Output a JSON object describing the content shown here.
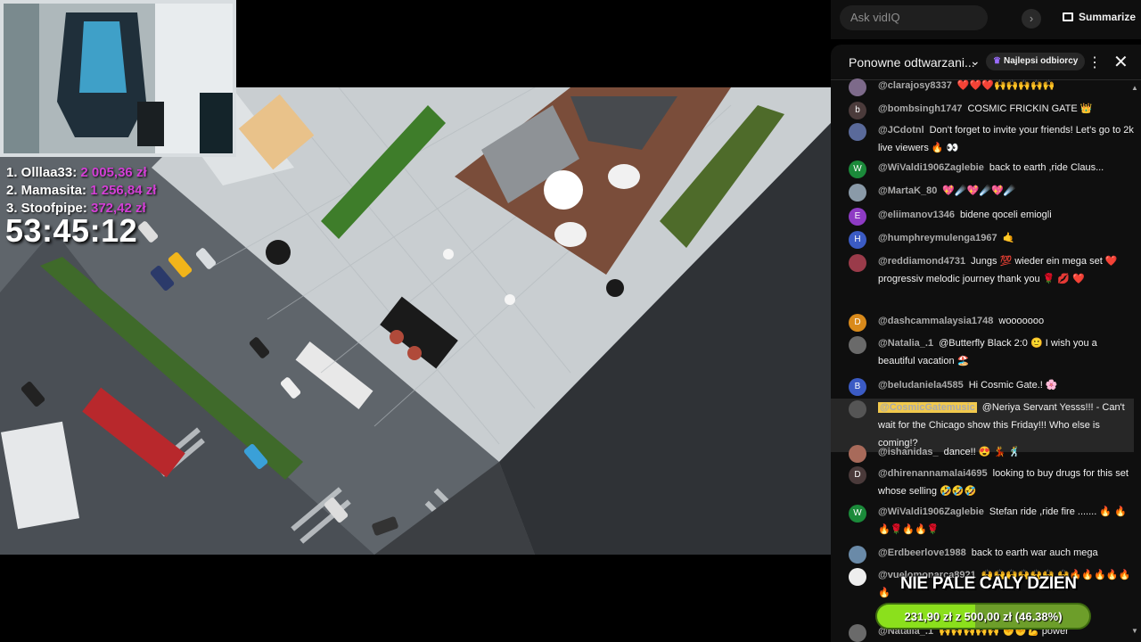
{
  "overlay": {
    "leaderboard": [
      {
        "label": "1. Olllaa33:",
        "amount": "2 005,36 zł"
      },
      {
        "label": "2. Mamasita:",
        "amount": "1 256,84 zł"
      },
      {
        "label": "3. Stoofpipe:",
        "amount": "372,42 zł"
      }
    ],
    "timer": "53:45:12",
    "goal": {
      "title": "NIE PALE CALY DZIEN",
      "text": "231,90 zł z 500,00 zł (46.38%)",
      "fraction": 0.4638
    }
  },
  "vidiq": {
    "placeholder": "Ask vidIQ",
    "arrow": "›",
    "summarize": "Summarize"
  },
  "chat": {
    "title": "Ponowne odtwarzani...",
    "chevron": "⌄",
    "top_donors": "Najlepsi odbiorcy",
    "menu": "⋮",
    "close": "✕",
    "messages": [
      {
        "author": "@clarajosy8337",
        "text": "❤️❤️❤️🙌🙌🙌🙌🙌",
        "avatar": "",
        "avatar_color": "#7d6a8a"
      },
      {
        "author": "@bombsingh1747",
        "text": "COSMIC FRICKIN GATE 👑",
        "avatar": "b",
        "avatar_color": "#4b3b3b"
      },
      {
        "author": "@JCdotnl",
        "text": "Don't forget to invite your friends! Let's go to 2k live viewers 🔥 👀",
        "avatar": "",
        "avatar_color": "#5a6a9a"
      },
      {
        "author": "@WiValdi1906Zaglebie",
        "text": "back to earth ,ride Claus...",
        "avatar": "W",
        "avatar_color": "#1b8a3a"
      },
      {
        "author": "@MartaK_80",
        "text": "💖☄️💖☄️💖☄️",
        "avatar": "",
        "avatar_color": "#8a9aa8"
      },
      {
        "author": "@eliimanov1346",
        "text": "bidene qoceli emiogli",
        "avatar": "E",
        "avatar_color": "#8e3bc4"
      },
      {
        "author": "@humphreymulenga1967",
        "text": "🤙",
        "avatar": "H",
        "avatar_color": "#3b5bc4"
      },
      {
        "author": "@reddiamond4731",
        "text": "Jungs 💯 wieder ein mega set ❤️ progressiv melodic journey thank you 🌹 💋 ❤️",
        "avatar": "",
        "avatar_color": "#9a3b4a"
      },
      {
        "author": "@dashcammalaysia1748",
        "text": "wooooooo",
        "avatar": "D",
        "avatar_color": "#d98a1b"
      },
      {
        "author": "@Natalia_.1",
        "text": "@Butterfly Black 2:0 🙂 I wish you a beautiful vacation 🏖️",
        "avatar": "",
        "avatar_color": "#6a6a6a"
      },
      {
        "author": "@beludaniela4585",
        "text": "Hi Cosmic Gate.! 🌸",
        "avatar": "B",
        "avatar_color": "#3b5bc4"
      },
      {
        "author": "@CosmicGatemusic",
        "text": "@Neriya Servant Yesss!!! - Can't wait for the Chicago show this Friday!!! Who else is coming!?",
        "avatar": "",
        "avatar_color": "#555555"
      },
      {
        "author": "@ishanidas_",
        "text": "dance!! 😍 💃 🕺",
        "avatar": "",
        "avatar_color": "#a86a5a"
      },
      {
        "author": "@dhirenannamalai4695",
        "text": "looking to buy drugs for this set whose selling 🤣🤣🤣",
        "avatar": "D",
        "avatar_color": "#4a3a3a"
      },
      {
        "author": "@WiValdi1906Zaglebie",
        "text": "Stefan ride ,ride fire ....... 🔥 🔥🔥🌹🔥🔥🌹",
        "avatar": "W",
        "avatar_color": "#1b8a3a"
      },
      {
        "author": "@Erdbeerlove1988",
        "text": "back to earth war auch mega",
        "avatar": "",
        "avatar_color": "#6a8aa8"
      },
      {
        "author": "@vuelomonarca8921",
        "text": "🙌🙌🙌🙌🙌🙌 🙌🔥🔥🔥🔥🔥🔥",
        "avatar": "",
        "avatar_color": "#eeeeee"
      },
      {
        "author": "@Natalia_.1",
        "text": "🙌🙌🙌🙌🙌 ✊✊💪 power",
        "avatar": "",
        "avatar_color": "#6a6a6a"
      }
    ]
  }
}
